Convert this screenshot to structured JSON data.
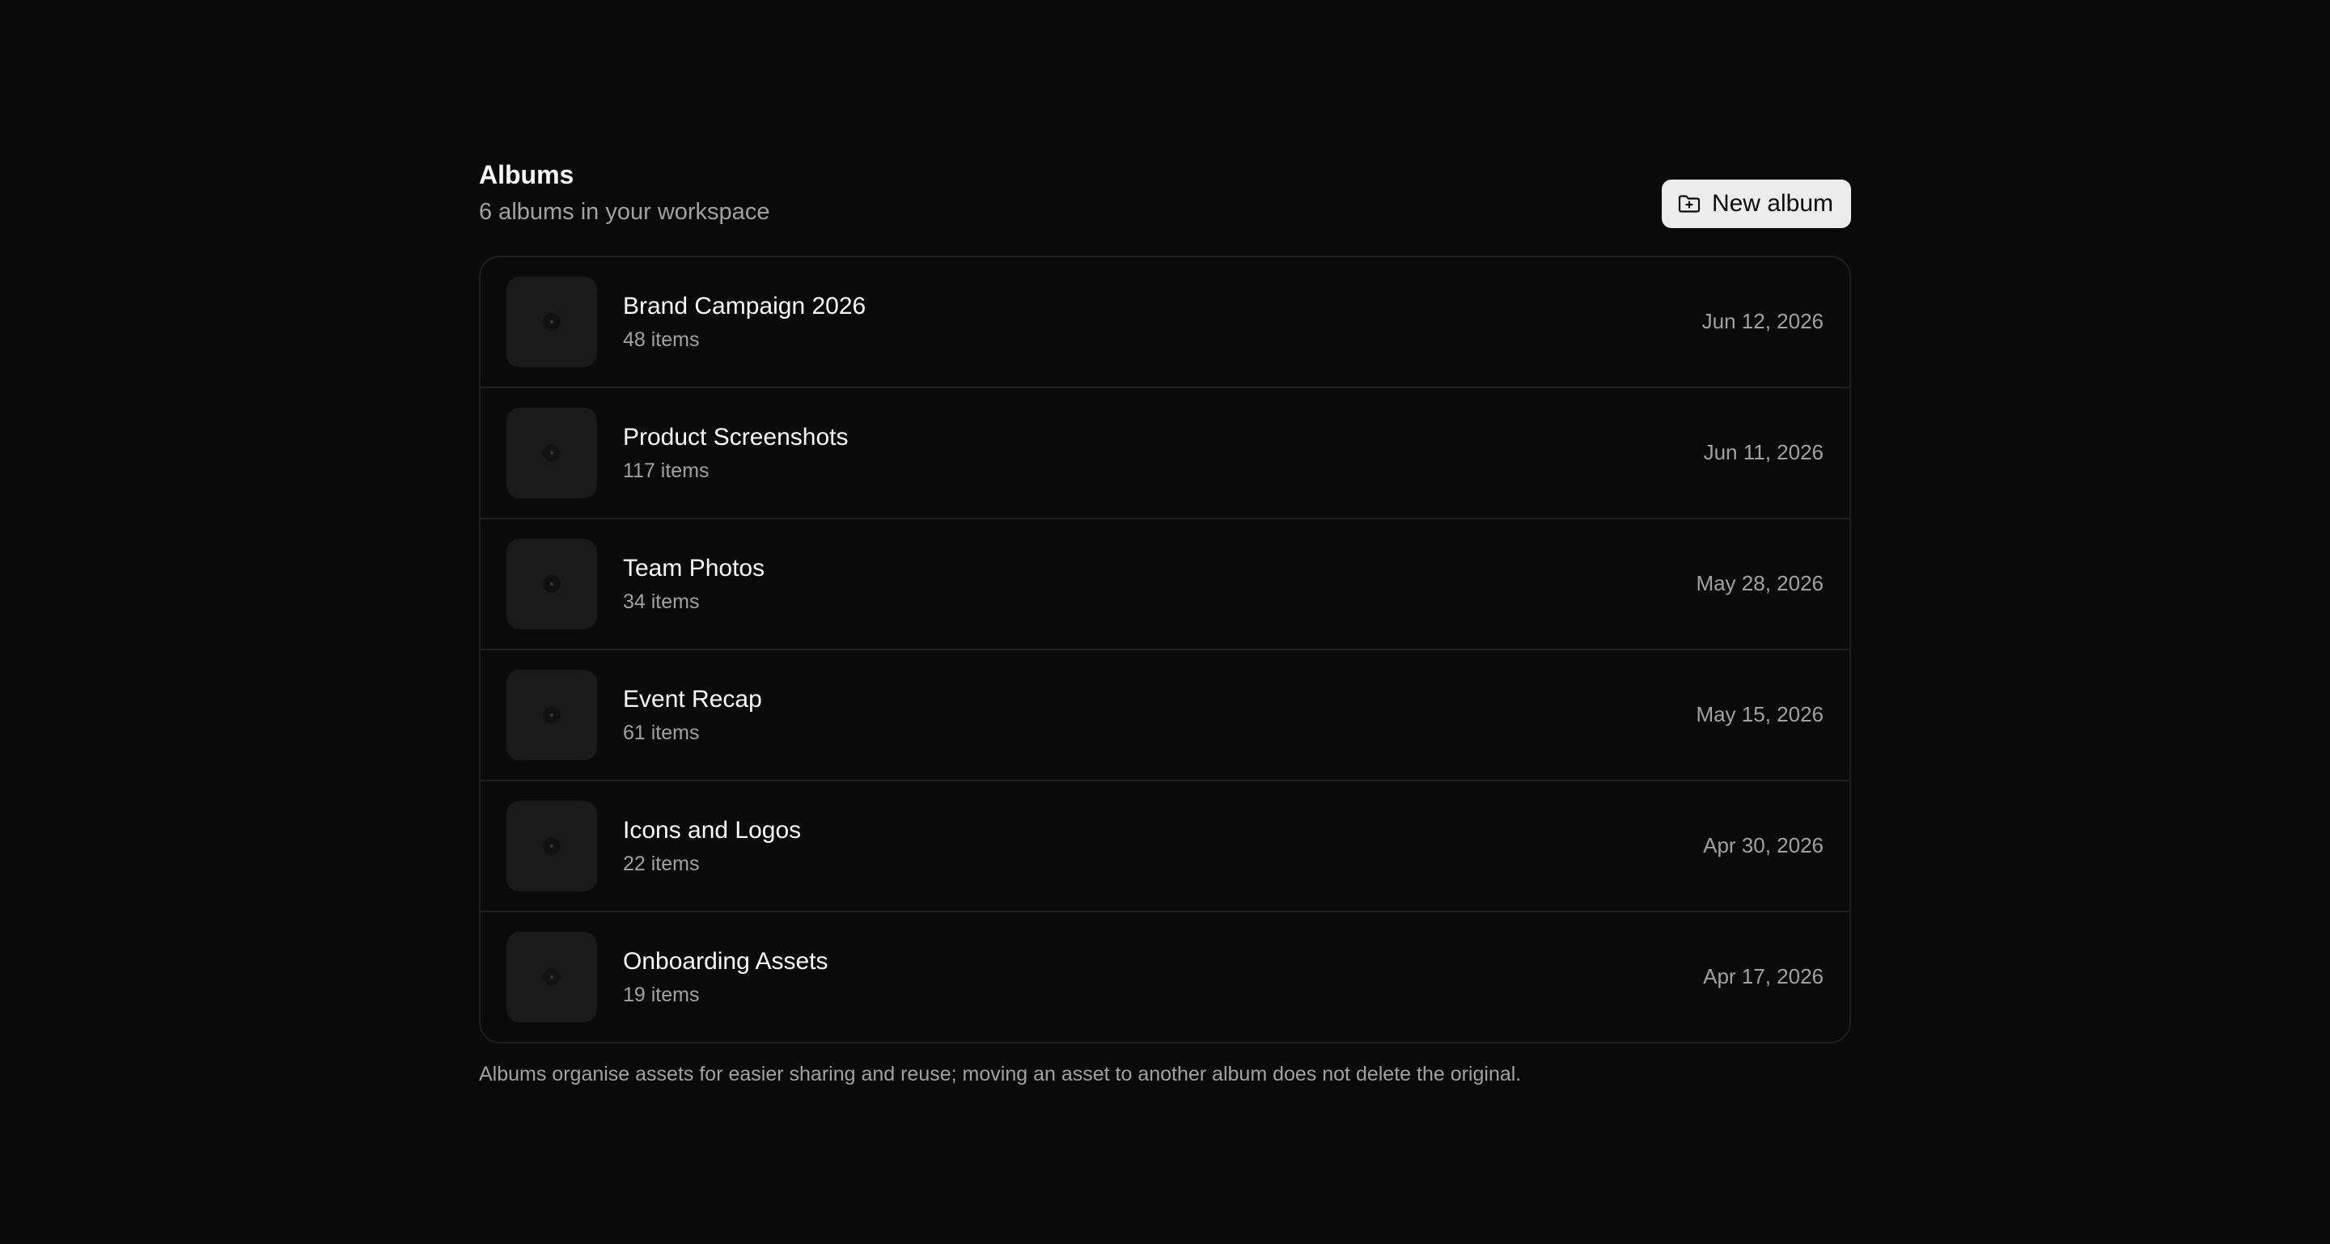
{
  "header": {
    "title": "Albums",
    "subtitle": "6 albums in your workspace",
    "new_album_label": "New album",
    "new_album_icon": "folder-plus-icon"
  },
  "albums": [
    {
      "name": "Brand Campaign 2026",
      "count": "48 items",
      "date": "Jun 12, 2026"
    },
    {
      "name": "Product Screenshots",
      "count": "117 items",
      "date": "Jun 11, 2026"
    },
    {
      "name": "Team Photos",
      "count": "34 items",
      "date": "May 28, 2026"
    },
    {
      "name": "Event Recap",
      "count": "61 items",
      "date": "May 15, 2026"
    },
    {
      "name": "Icons and Logos",
      "count": "22 items",
      "date": "Apr 30, 2026"
    },
    {
      "name": "Onboarding Assets",
      "count": "19 items",
      "date": "Apr 17, 2026"
    }
  ],
  "footnote": "Albums organise assets for easier sharing and reuse; moving an asset to another album does not delete the original.",
  "colors": {
    "background": "#0a0a0a",
    "button_bg": "#ececec",
    "muted_text": "#a1a1a1",
    "border": "#1f1f1f"
  }
}
